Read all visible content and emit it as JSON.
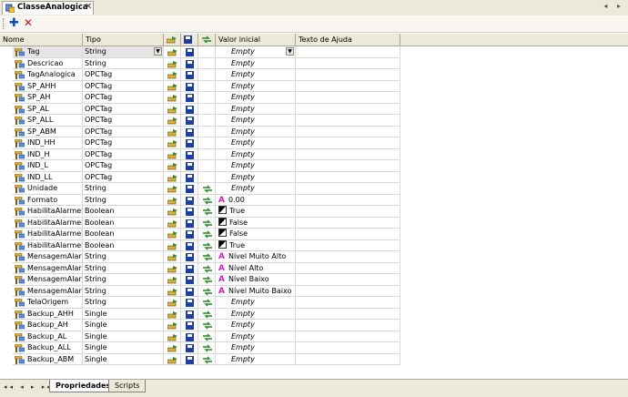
{
  "tab": {
    "title": "ClasseAnalogica",
    "close": "✕"
  },
  "nav_arrows": "◂ ▸",
  "toolbar": {
    "add": "✚",
    "delete": "✕"
  },
  "columns": {
    "name": "Nome",
    "type": "Tipo",
    "icon1": "read-write-icon",
    "icon2": "save-icon",
    "icon3": "link-icon",
    "value": "Valor inicial",
    "help": "Texto de Ajuda"
  },
  "rows": [
    {
      "name": "Tag",
      "type": "String",
      "icons": [
        1,
        1,
        0
      ],
      "value": "Empty",
      "empty": true,
      "kind": "dropdown"
    },
    {
      "name": "Descricao",
      "type": "String",
      "icons": [
        1,
        1,
        0
      ],
      "value": "Empty",
      "empty": true
    },
    {
      "name": "TagAnalogica",
      "type": "OPCTag",
      "icons": [
        1,
        1,
        0
      ],
      "value": "Empty",
      "empty": true
    },
    {
      "name": "SP_AHH",
      "type": "OPCTag",
      "icons": [
        1,
        1,
        0
      ],
      "value": "Empty",
      "empty": true
    },
    {
      "name": "SP_AH",
      "type": "OPCTag",
      "icons": [
        1,
        1,
        0
      ],
      "value": "Empty",
      "empty": true
    },
    {
      "name": "SP_AL",
      "type": "OPCTag",
      "icons": [
        1,
        1,
        0
      ],
      "value": "Empty",
      "empty": true
    },
    {
      "name": "SP_ALL",
      "type": "OPCTag",
      "icons": [
        1,
        1,
        0
      ],
      "value": "Empty",
      "empty": true
    },
    {
      "name": "SP_ABM",
      "type": "OPCTag",
      "icons": [
        1,
        1,
        0
      ],
      "value": "Empty",
      "empty": true
    },
    {
      "name": "IND_HH",
      "type": "OPCTag",
      "icons": [
        1,
        1,
        0
      ],
      "value": "Empty",
      "empty": true
    },
    {
      "name": "IND_H",
      "type": "OPCTag",
      "icons": [
        1,
        1,
        0
      ],
      "value": "Empty",
      "empty": true
    },
    {
      "name": "IND_L",
      "type": "OPCTag",
      "icons": [
        1,
        1,
        0
      ],
      "value": "Empty",
      "empty": true
    },
    {
      "name": "IND_LL",
      "type": "OPCTag",
      "icons": [
        1,
        1,
        0
      ],
      "value": "Empty",
      "empty": true
    },
    {
      "name": "Unidade",
      "type": "String",
      "icons": [
        1,
        1,
        1
      ],
      "value": "Empty",
      "empty": true
    },
    {
      "name": "Formato",
      "type": "String",
      "icons": [
        1,
        1,
        1
      ],
      "value": "0.00",
      "kind": "text"
    },
    {
      "name": "HabilitaAlarmeHH",
      "type": "Boolean",
      "icons": [
        1,
        1,
        1
      ],
      "value": "True",
      "kind": "bool"
    },
    {
      "name": "HabilitaAlarmeH",
      "type": "Boolean",
      "icons": [
        1,
        1,
        1
      ],
      "value": "False",
      "kind": "bool"
    },
    {
      "name": "HabilitaAlarmeL",
      "type": "Boolean",
      "icons": [
        1,
        1,
        1
      ],
      "value": "False",
      "kind": "bool"
    },
    {
      "name": "HabilitaAlarmeLL",
      "type": "Boolean",
      "icons": [
        1,
        1,
        1
      ],
      "value": "True",
      "kind": "bool"
    },
    {
      "name": "MensagemAlarmeHH",
      "type": "String",
      "icons": [
        1,
        1,
        1
      ],
      "value": "Nível Muito Alto",
      "kind": "text"
    },
    {
      "name": "MensagemAlarmeH",
      "type": "String",
      "icons": [
        1,
        1,
        1
      ],
      "value": "Nível Alto",
      "kind": "text"
    },
    {
      "name": "MensagemAlarmeL",
      "type": "String",
      "icons": [
        1,
        1,
        1
      ],
      "value": "Nível Baixo",
      "kind": "text"
    },
    {
      "name": "MensagemAlarmeLL",
      "type": "String",
      "icons": [
        1,
        1,
        1
      ],
      "value": "Nível Muito Baixo",
      "kind": "text"
    },
    {
      "name": "TelaOrigem",
      "type": "String",
      "icons": [
        1,
        1,
        1
      ],
      "value": "Empty",
      "empty": true
    },
    {
      "name": "Backup_AHH",
      "type": "Single",
      "icons": [
        1,
        1,
        1
      ],
      "value": "Empty",
      "empty": true
    },
    {
      "name": "Backup_AH",
      "type": "Single",
      "icons": [
        1,
        1,
        1
      ],
      "value": "Empty",
      "empty": true
    },
    {
      "name": "Backup_AL",
      "type": "Single",
      "icons": [
        1,
        1,
        1
      ],
      "value": "Empty",
      "empty": true
    },
    {
      "name": "Backup_ALL",
      "type": "Single",
      "icons": [
        1,
        1,
        1
      ],
      "value": "Empty",
      "empty": true
    },
    {
      "name": "Backup_ABM",
      "type": "Single",
      "icons": [
        1,
        1,
        1
      ],
      "value": "Empty",
      "empty": true
    }
  ],
  "bottom_nav": "◂◂ ◂ ▸ ▸▸",
  "bottom_tabs": [
    {
      "label": "Propriedades",
      "active": true
    },
    {
      "label": "Scripts",
      "active": false
    }
  ]
}
